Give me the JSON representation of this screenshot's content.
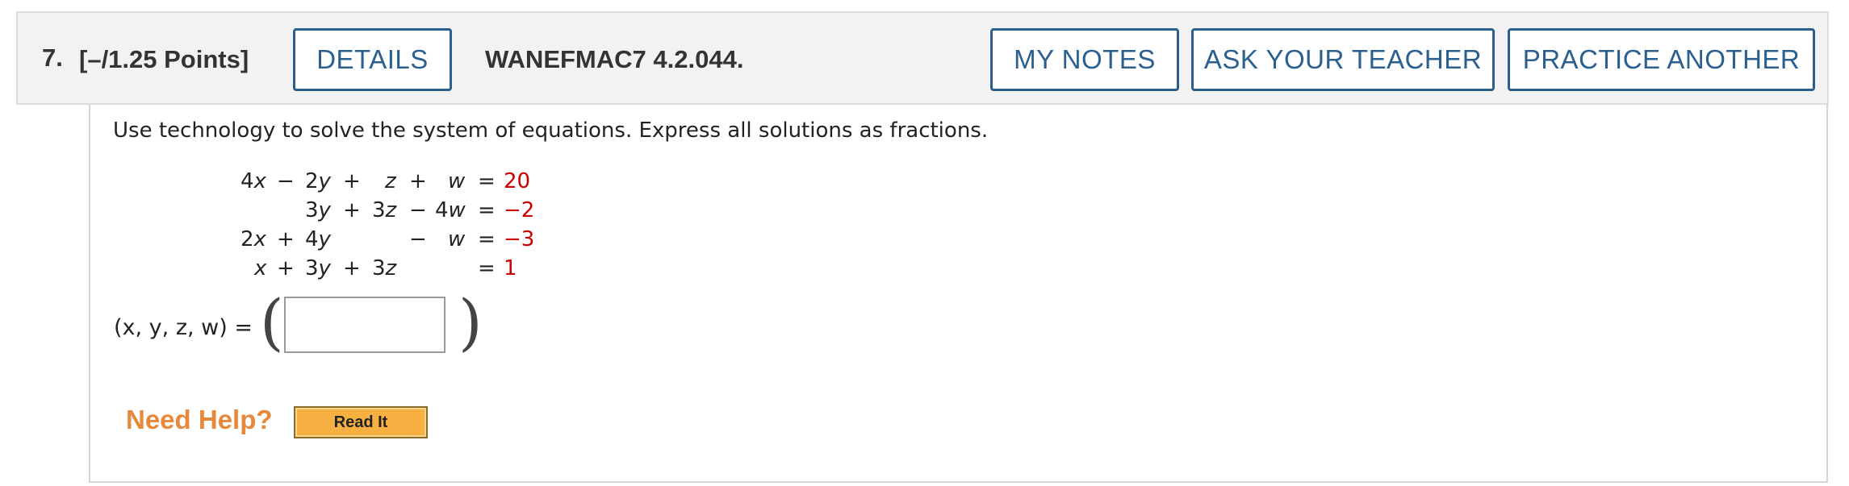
{
  "header": {
    "question_number": "7.",
    "points": "[–/1.25 Points]",
    "details_label": "DETAILS",
    "problem_code": "WANEFMAC7 4.2.044.",
    "my_notes_label": "MY NOTES",
    "ask_teacher_label": "ASK YOUR TEACHER",
    "practice_another_label": "PRACTICE ANOTHER"
  },
  "question": {
    "instruction": "Use technology to solve the system of equations. Express all solutions as fractions.",
    "equations": [
      {
        "terms": [
          {
            "text": "4",
            "var": "x"
          },
          {
            "text": "−"
          },
          {
            "text": "2",
            "var": "y"
          },
          {
            "text": "+"
          },
          {
            "text": "",
            "var": "z"
          },
          {
            "text": "+"
          },
          {
            "text": "",
            "var": "w"
          },
          {
            "text": "="
          }
        ],
        "rhs": "20"
      },
      {
        "terms": [
          {
            "text": "3",
            "var": "y"
          },
          {
            "text": "+"
          },
          {
            "text": "3",
            "var": "z"
          },
          {
            "text": "−"
          },
          {
            "text": "4",
            "var": "w"
          },
          {
            "text": "="
          }
        ],
        "rhs": "−2"
      },
      {
        "terms": [
          {
            "text": "2",
            "var": "x"
          },
          {
            "text": "+"
          },
          {
            "text": "4",
            "var": "y"
          },
          {
            "text": "−"
          },
          {
            "text": "",
            "var": "w"
          },
          {
            "text": "="
          }
        ],
        "rhs": "−3"
      },
      {
        "terms": [
          {
            "text": "",
            "var": "x"
          },
          {
            "text": "+"
          },
          {
            "text": "3",
            "var": "y"
          },
          {
            "text": "+"
          },
          {
            "text": "3",
            "var": "z"
          },
          {
            "text": "="
          }
        ],
        "rhs": "1"
      }
    ],
    "answer_label": "(x, y, z, w) =",
    "answer_value": ""
  },
  "help": {
    "need_help_label": "Need Help?",
    "read_it_label": "Read It"
  },
  "colors": {
    "button_border": "#2b5f8f",
    "rhs_value": "#cc0000",
    "need_help": "#e8883a",
    "read_it_bg": "#f5b041"
  }
}
